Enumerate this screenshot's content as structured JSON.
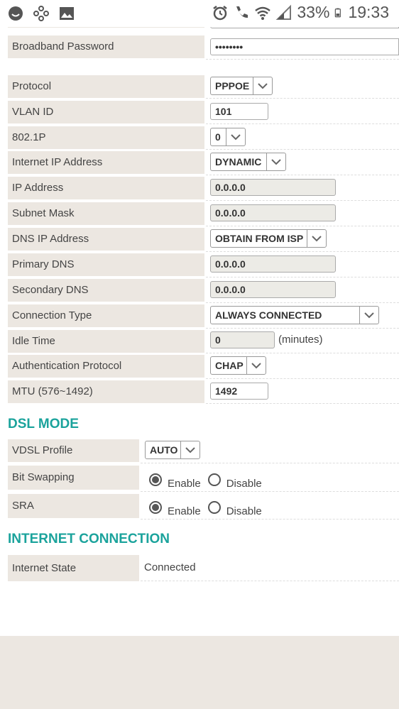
{
  "status_bar": {
    "battery": "33%",
    "time": "19:33",
    "left_icons": [
      "face-icon",
      "flower-icon",
      "image-icon"
    ],
    "right_icons": [
      "alarm-icon",
      "wifi-call-icon",
      "wifi-icon",
      "signal-icon",
      "battery-icon"
    ]
  },
  "top_partial_field": {
    "value": ""
  },
  "broadband_password": {
    "label": "Broadband Password",
    "value": "••••••••"
  },
  "wan": {
    "protocol": {
      "label": "Protocol",
      "value": "PPPOE"
    },
    "vlan_id": {
      "label": "VLAN ID",
      "value": "101"
    },
    "p8021": {
      "label": "802.1P",
      "value": "0"
    },
    "internet_ip": {
      "label": "Internet IP Address",
      "value": "DYNAMIC"
    },
    "ip_address": {
      "label": "IP Address",
      "value": "0.0.0.0"
    },
    "subnet_mask": {
      "label": "Subnet Mask",
      "value": "0.0.0.0"
    },
    "dns_ip": {
      "label": "DNS IP Address",
      "value": "OBTAIN FROM ISP"
    },
    "primary_dns": {
      "label": "Primary DNS",
      "value": "0.0.0.0"
    },
    "secondary_dns": {
      "label": "Secondary DNS",
      "value": "0.0.0.0"
    },
    "connection_type": {
      "label": "Connection Type",
      "value": "ALWAYS CONNECTED"
    },
    "idle_time": {
      "label": "Idle Time",
      "value": "0",
      "suffix": "(minutes)"
    },
    "auth_protocol": {
      "label": "Authentication Protocol",
      "value": "CHAP"
    },
    "mtu": {
      "label": "MTU (576~1492)",
      "value": "1492"
    }
  },
  "dsl_mode": {
    "title": "DSL MODE",
    "vdsl_profile": {
      "label": "VDSL Profile",
      "value": "AUTO"
    },
    "bit_swapping": {
      "label": "Bit Swapping",
      "enable": "Enable",
      "disable": "Disable",
      "selected": "Enable"
    },
    "sra": {
      "label": "SRA",
      "enable": "Enable",
      "disable": "Disable",
      "selected": "Enable"
    }
  },
  "internet_connection": {
    "title": "INTERNET CONNECTION",
    "state": {
      "label": "Internet State",
      "value": "Connected"
    }
  },
  "colors": {
    "accent": "#1ba39c",
    "label_bg": "#ece7e1"
  }
}
